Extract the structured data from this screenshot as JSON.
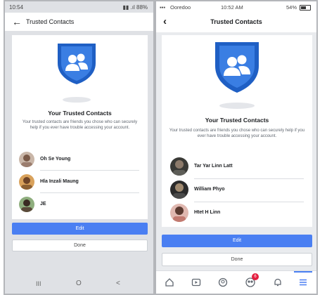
{
  "left": {
    "status_time": "10:54",
    "status_right": "▮▮ .ıl 88%",
    "header_title": "Trusted Contacts",
    "heading": "Your Trusted Contacts",
    "description": "Your trusted contacts are friends you chose who can securely help if you ever have trouble accessing your account.",
    "contacts": [
      {
        "name": "Oh Se Young"
      },
      {
        "name": "Hla Inzali Maung"
      },
      {
        "name": "JE"
      }
    ],
    "edit_label": "Edit",
    "done_label": "Done",
    "nav": {
      "recent": "III",
      "home": "O",
      "back": "<"
    }
  },
  "right": {
    "carrier": "Ooredoo",
    "status_time": "10:52 AM",
    "battery": "54%",
    "header_title": "Trusted Contacts",
    "heading": "Your Trusted Contacts",
    "description": "Your trusted contacts are friends you chose who can securely help if you ever have trouble accessing your account.",
    "contacts": [
      {
        "name": "Tar Yar Linn Latt"
      },
      {
        "name": "William Phyo"
      },
      {
        "name": "Htet H Linn"
      }
    ],
    "edit_label": "Edit",
    "done_label": "Done",
    "groups_badge": "6"
  },
  "colors": {
    "accent": "#4a7ff2",
    "shield": "#2c6fd8",
    "badge": "#e41e3f"
  }
}
